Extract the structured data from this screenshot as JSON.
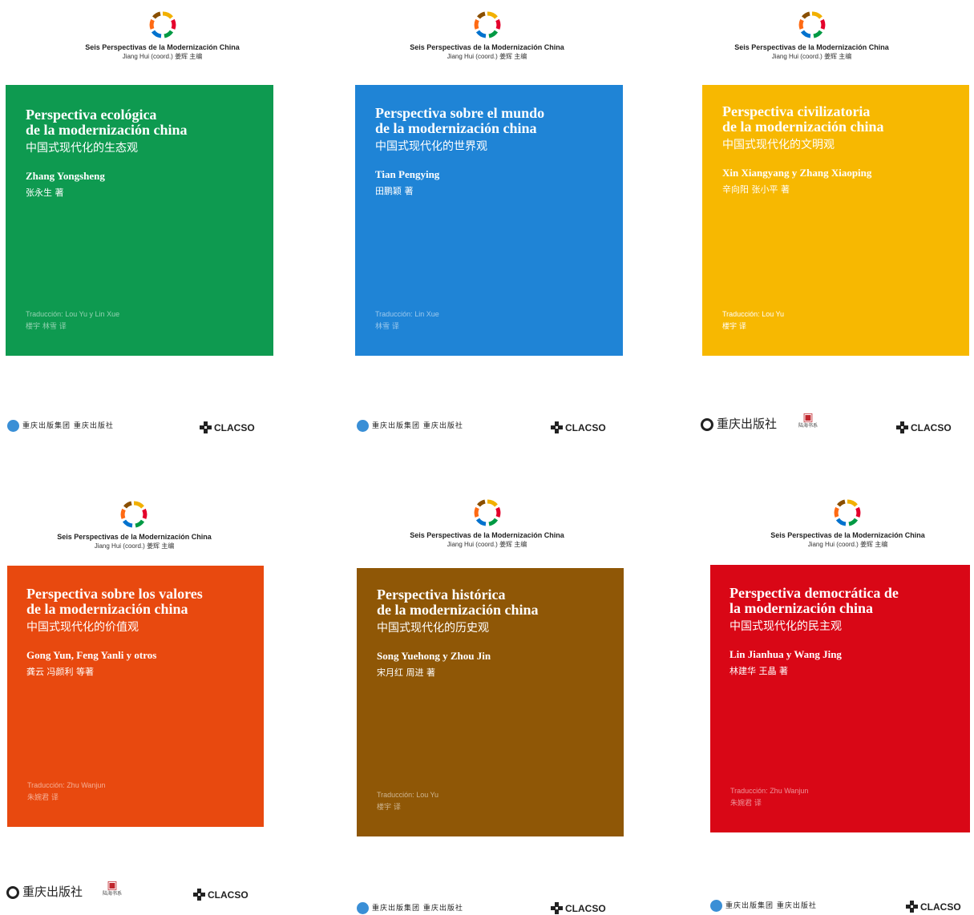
{
  "series_title": "Seis Perspectivas de la Modernización China",
  "coordinator": "Jiang Hui (coord.) 姜辉 主编",
  "colors": {
    "green": "#0e9a50",
    "blue": "#1f84d6",
    "yellow": "#f7b801",
    "orange": "#e8490f",
    "brown": "#8f5706",
    "red": "#d90716"
  },
  "logo_icon": "ring-of-colored-segments-icon",
  "covers": [
    {
      "title_es_1": "Perspectiva ecológica",
      "title_es_2": "de la modernización china",
      "title_zh": "中国式现代化的生态观",
      "author": "Zhang Yongsheng",
      "author_zh": "张永生 著",
      "translation": "Traducción: Lou Yu y Lin Xue",
      "translation_zh": "楼宇 林雪 译",
      "publisher": "重庆出版集团 重庆出版社",
      "clacso": "CLACSO"
    },
    {
      "title_es_1": "Perspectiva sobre el mundo",
      "title_es_2": "de la modernización china",
      "title_zh": "中国式现代化的世界观",
      "author": "Tian Pengying",
      "author_zh": "田鹏颖 著",
      "translation": "Traducción: Lin Xue",
      "translation_zh": "林雪 译",
      "publisher": "重庆出版集团 重庆出版社",
      "clacso": "CLACSO"
    },
    {
      "title_es_1": "Perspectiva civilizatoria",
      "title_es_2": "de la modernización china",
      "title_zh": "中国式现代化的文明观",
      "author": "Xin Xiangyang y Zhang Xiaoping",
      "author_zh": "辛向阳 张小平 著",
      "translation": "Traducción: Lou Yu",
      "translation_zh": "楼宇 译",
      "publisher": "重庆出版社",
      "imprint": "陆海书系",
      "clacso": "CLACSO"
    },
    {
      "title_es_1": "Perspectiva sobre los valores",
      "title_es_2": "de la modernización china",
      "title_zh": "中国式现代化的价值观",
      "author": "Gong Yun, Feng Yanli y otros",
      "author_zh": "龚云 冯颜利 等著",
      "translation": "Traducción: Zhu Wanjun",
      "translation_zh": "朱婉君 译",
      "publisher": "重庆出版社",
      "imprint": "陆海书系",
      "clacso": "CLACSO"
    },
    {
      "title_es_1": "Perspectiva histórica",
      "title_es_2": "de la modernización china",
      "title_zh": "中国式现代化的历史观",
      "author": "Song Yuehong y Zhou Jin",
      "author_zh": "宋月红 周进 著",
      "translation": "Traducción: Lou Yu",
      "translation_zh": "楼宇 译",
      "publisher": "重庆出版集团 重庆出版社",
      "clacso": "CLACSO"
    },
    {
      "title_es_1": "Perspectiva democrática de",
      "title_es_2": "la modernización china",
      "title_zh": "中国式现代化的民主观",
      "author": "Lin Jianhua y Wang Jing",
      "author_zh": "林建华 王晶 著",
      "translation": "Traducción: Zhu Wanjun",
      "translation_zh": "朱婉君 译",
      "publisher": "重庆出版集团 重庆出版社",
      "clacso": "CLACSO"
    }
  ]
}
